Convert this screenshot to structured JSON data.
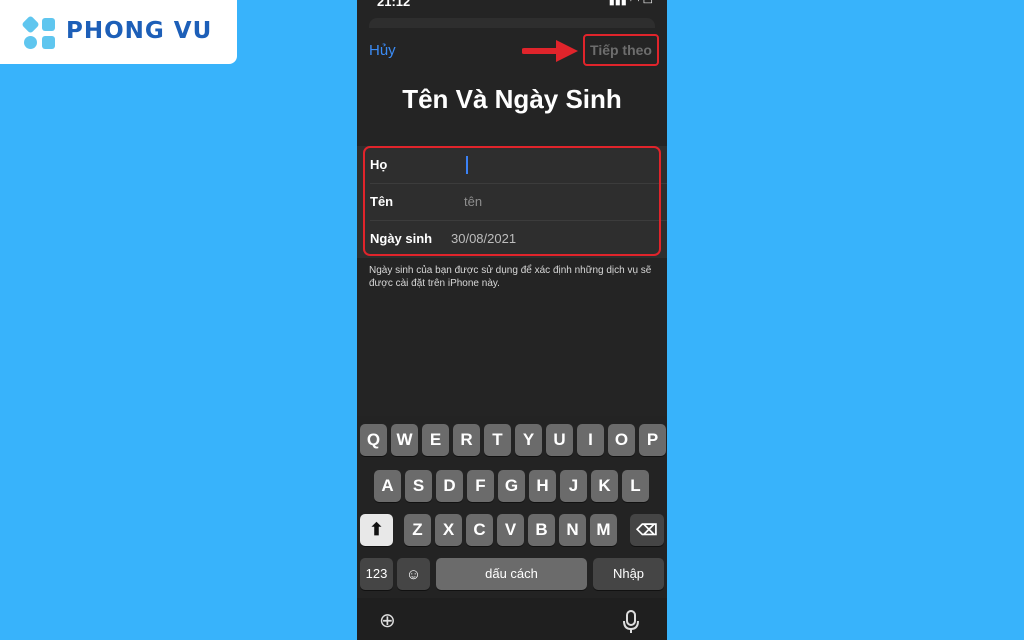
{
  "brand": {
    "name": "PHONG VU",
    "colors": {
      "primary": "#1d5fb8",
      "accent": "#5fc6ef"
    }
  },
  "status_bar": {
    "time": "21:12",
    "icons": [
      "signal-icon",
      "wifi-icon",
      "battery-icon"
    ]
  },
  "nav": {
    "cancel_label": "Hủy",
    "next_label": "Tiếp theo"
  },
  "page": {
    "title": "Tên Và Ngày Sinh"
  },
  "form": {
    "last_name": {
      "label": "Họ",
      "value": ""
    },
    "first_name": {
      "label": "Tên",
      "placeholder": "tên"
    },
    "birthday": {
      "label": "Ngày sinh",
      "value": "30/08/2021"
    }
  },
  "note": "Ngày sinh của bạn được sử dụng để xác định những dịch vụ sẽ được cài đặt trên iPhone này.",
  "keyboard": {
    "row1": [
      "Q",
      "W",
      "E",
      "R",
      "T",
      "Y",
      "U",
      "I",
      "O",
      "P"
    ],
    "row2": [
      "A",
      "S",
      "D",
      "F",
      "G",
      "H",
      "J",
      "K",
      "L"
    ],
    "row3": [
      "Z",
      "X",
      "C",
      "V",
      "B",
      "N",
      "M"
    ],
    "numbers_label": "123",
    "space_label": "dấu cách",
    "return_label": "Nhập"
  },
  "colors": {
    "highlight": "#e0242b",
    "link": "#3b8cf5",
    "background": "#38b3fb"
  }
}
